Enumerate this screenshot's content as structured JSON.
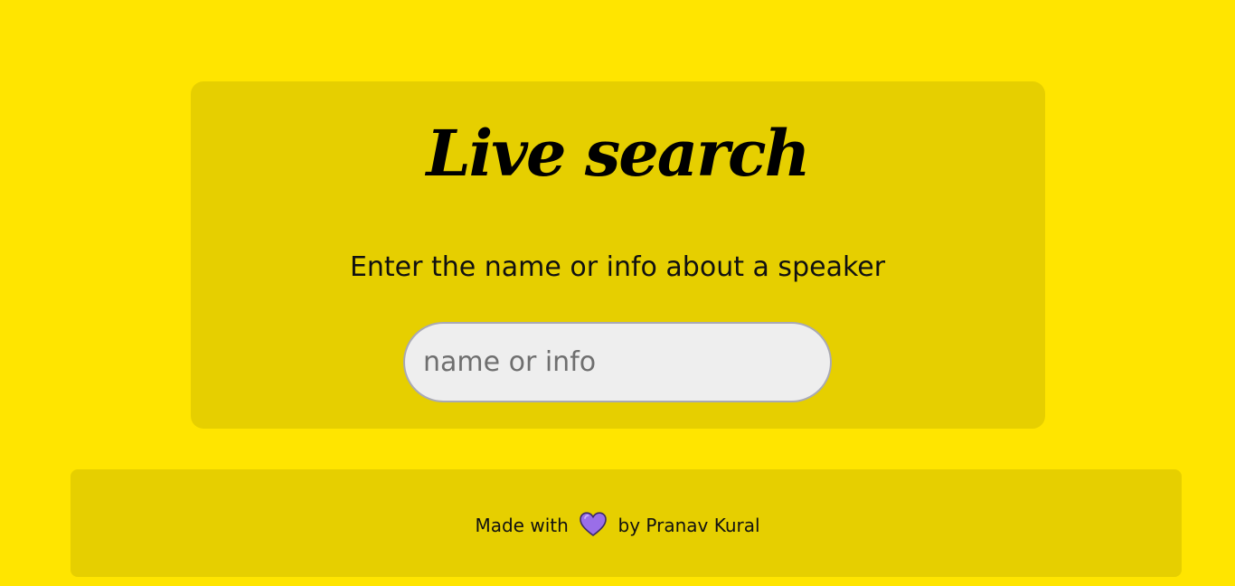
{
  "page": {
    "background_color": "#ffe500",
    "panel_color": "#e6cf00"
  },
  "search_card": {
    "title": "Live search",
    "subtitle": "Enter the name or info about a speaker",
    "input": {
      "placeholder": "name or info",
      "value": ""
    }
  },
  "footer": {
    "prefix": "Made with",
    "icon": "heart-icon",
    "icon_color": "#9a6ee8",
    "suffix": "by Pranav Kural"
  }
}
